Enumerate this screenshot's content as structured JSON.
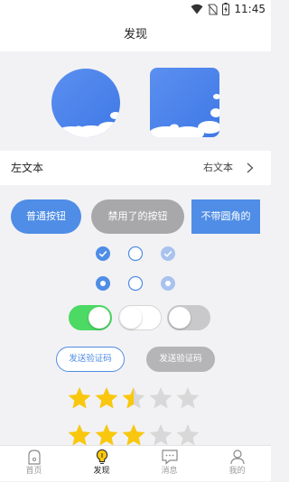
{
  "status_bar": {
    "time": "11:45"
  },
  "navbar": {
    "title": "发现"
  },
  "list_row": {
    "left_text": "左文本",
    "right_text": "右文本"
  },
  "buttons": {
    "normal": "普通按钮",
    "disabled": "禁用了的按钮",
    "square": "不带圆角的"
  },
  "checkboxes": {
    "row1": [
      "checked",
      "unchecked",
      "checked-disabled"
    ],
    "row2": [
      "selected",
      "unselected",
      "selected-disabled"
    ]
  },
  "switches": [
    "on",
    "off",
    "off-disabled"
  ],
  "verify": {
    "active": "发送验证码",
    "disabled": "发送验证码"
  },
  "ratings": {
    "row1": 2.5,
    "row2": 3,
    "max": 5
  },
  "tabs": [
    {
      "label": "首页",
      "icon": "home-icon",
      "active": false
    },
    {
      "label": "发现",
      "icon": "bulb-icon",
      "active": true
    },
    {
      "label": "消息",
      "icon": "message-icon",
      "active": false
    },
    {
      "label": "我的",
      "icon": "person-icon",
      "active": false
    }
  ],
  "colors": {
    "primary": "#4f8de6",
    "switch_on": "#4cd964",
    "star_active": "#f9c80e",
    "star_inactive": "#d8d8d8",
    "disabled": "#a8a8ab",
    "tab_active": "#222222",
    "tab_inactive": "#999999"
  }
}
